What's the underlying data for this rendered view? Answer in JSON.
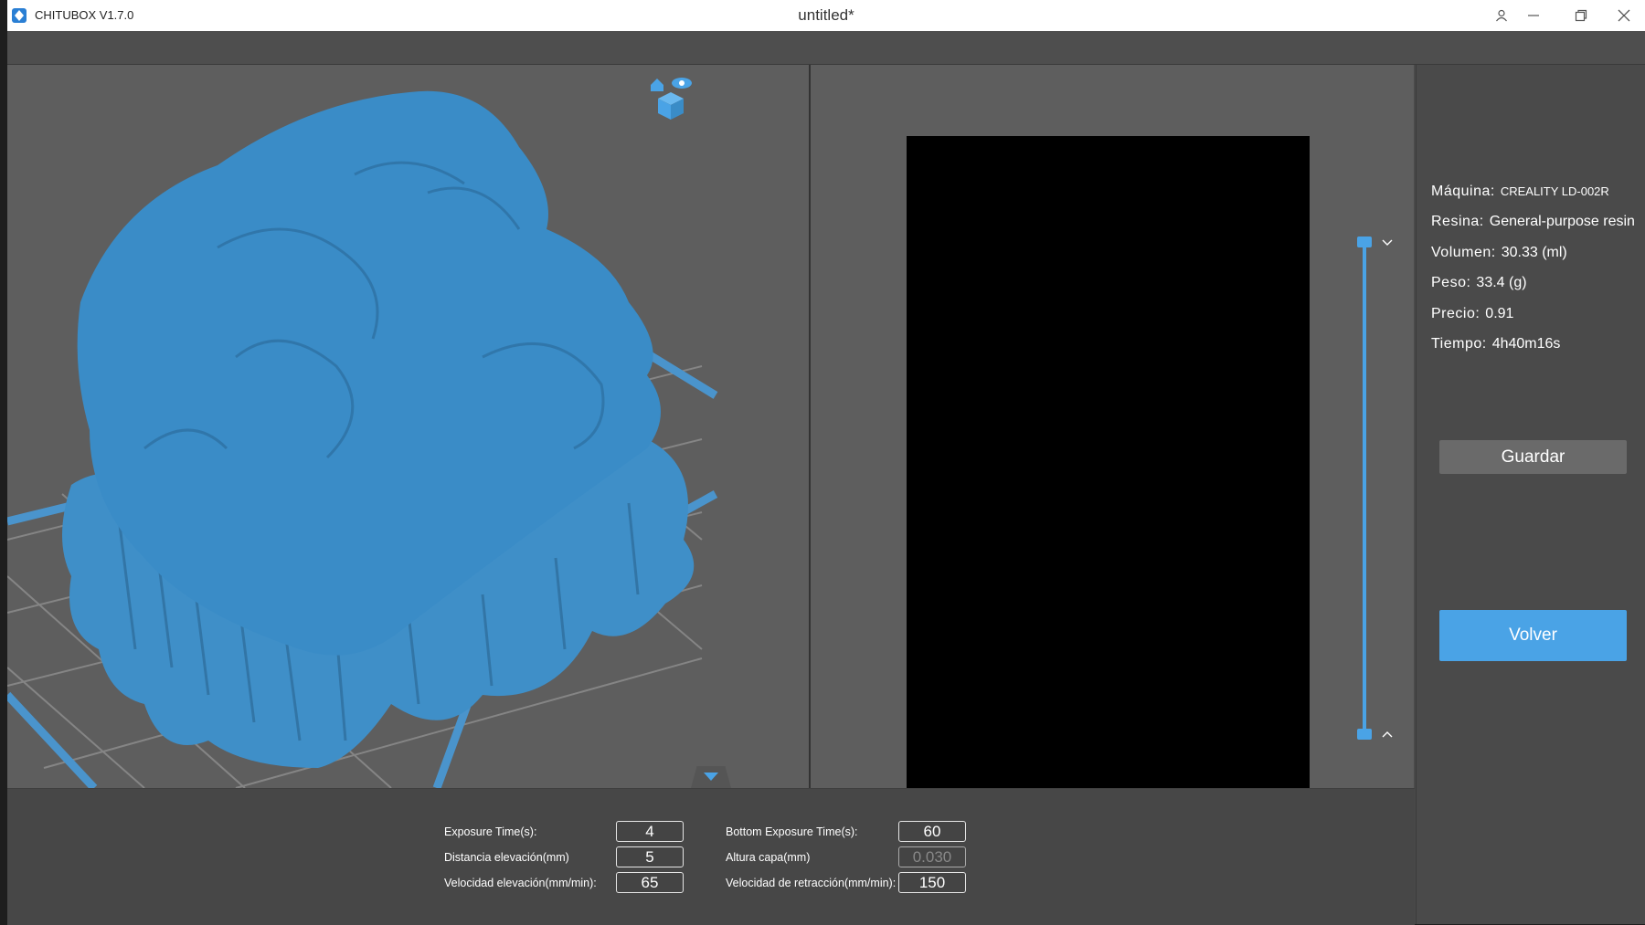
{
  "titlebar": {
    "app_name": "CHITUBOX V1.7.0",
    "document_title": "untitled*",
    "accent_color": "#4aa3e6"
  },
  "info": {
    "machine_label": "Máquina:",
    "machine_value": "CREALITY LD-002R",
    "resin_label": "Resina:",
    "resin_value": "General-purpose resin",
    "volume_label": "Volumen:",
    "volume_value": "30.33  (ml)",
    "weight_label": "Peso:",
    "weight_value": "33.4  (g)",
    "price_label": "Precio:",
    "price_value": "0.91",
    "time_label": "Tiempo:",
    "time_value": "4h40m16s"
  },
  "buttons": {
    "save_label": "Guardar",
    "back_label": "Volver"
  },
  "params": {
    "exposure_label": "Exposure Time(s):",
    "exposure_value": "4",
    "bottom_exposure_label": "Bottom Exposure Time(s):",
    "bottom_exposure_value": "60",
    "lift_distance_label": "Distancia elevación(mm)",
    "lift_distance_value": "5",
    "layer_height_label": "Altura capa(mm)",
    "layer_height_value": "0.030",
    "lift_speed_label": "Velocidad elevación(mm/min):",
    "lift_speed_value": "65",
    "retract_speed_label": "Velocidad de retracción(mm/min):",
    "retract_speed_value": "150"
  },
  "icons": {
    "logo": "chitubox-logo-icon",
    "user": "user-icon",
    "minimize": "minimize-icon",
    "restore": "restore-icon",
    "close": "close-icon",
    "view_cube": "view-cube-icon",
    "home": "home-icon",
    "eye": "eye-icon"
  }
}
